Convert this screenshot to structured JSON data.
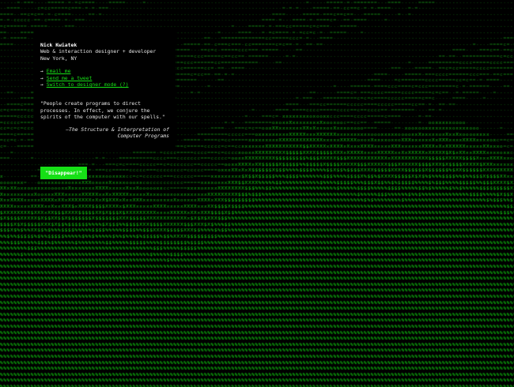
{
  "profile": {
    "name": "Nick Kwiatek",
    "role": "Web & interaction designer + developer",
    "location": "New York, NY"
  },
  "links": [
    {
      "arrow": "→",
      "label": "Email me",
      "icon": "right-arrow-icon"
    },
    {
      "arrow": "→",
      "label": "Send me a tweet",
      "icon": "right-arrow-icon"
    },
    {
      "arrow": "→",
      "label": "Switch to designer mode (?)",
      "icon": "right-arrow-icon"
    }
  ],
  "quote": {
    "text": "\"People create programs to direct processes. In effect, we conjure the spirits of the computer with our spells.\"",
    "attribution_prefix": "—",
    "attribution_title": "The Structure & Interpretation of Computer Programs"
  },
  "disappear_button": {
    "label": "\"Disappear!\""
  },
  "colors": {
    "background": "#000000",
    "accent_green": "#16e016",
    "text": "#e6e6e6"
  }
}
